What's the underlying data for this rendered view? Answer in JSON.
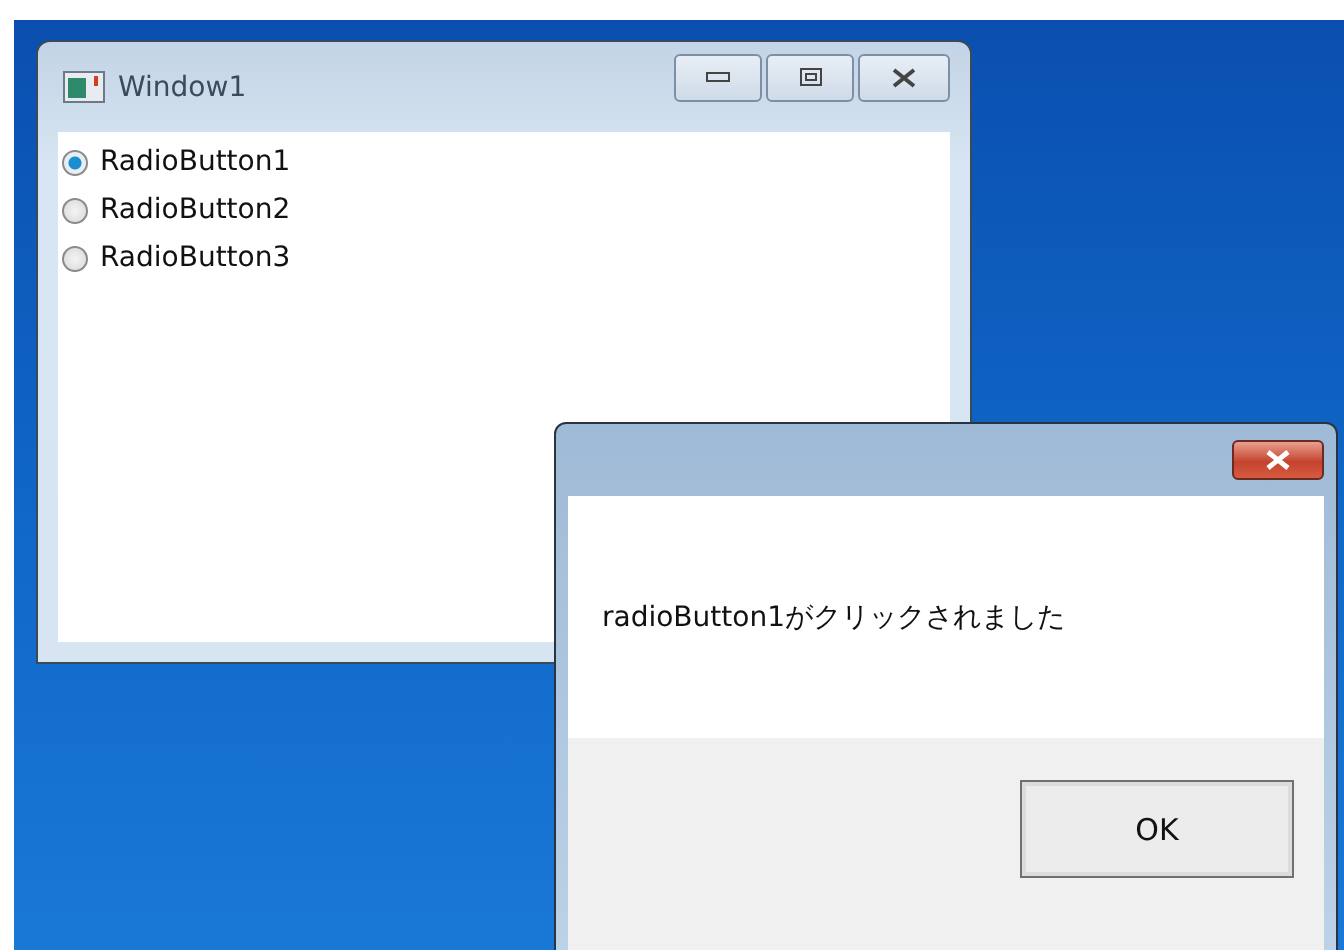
{
  "window": {
    "title": "Window1"
  },
  "radios": [
    {
      "label": "RadioButton1",
      "selected": true
    },
    {
      "label": "RadioButton2",
      "selected": false
    },
    {
      "label": "RadioButton3",
      "selected": false
    }
  ],
  "dialog": {
    "message": "radioButton1がクリックされました",
    "buttons": [
      "OK"
    ]
  }
}
